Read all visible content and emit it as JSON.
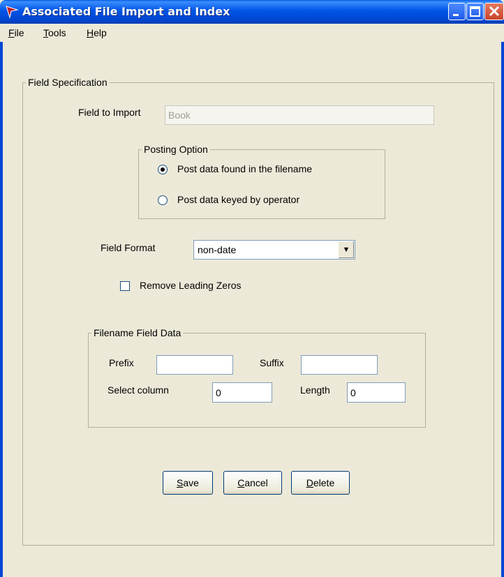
{
  "window": {
    "title": "Associated File Import and Index"
  },
  "menu": {
    "file": {
      "accel": "F",
      "rest": "ile"
    },
    "tools": {
      "accel": "T",
      "rest": "ools"
    },
    "help": {
      "accel": "H",
      "rest": "elp"
    }
  },
  "field_spec": {
    "legend": "Field Specification",
    "field_to_import_label": "Field to Import",
    "field_to_import_value": "Book"
  },
  "posting_option": {
    "legend": "Posting Option",
    "options": [
      {
        "label": "Post data found in the filename",
        "selected": true
      },
      {
        "label": "Post data keyed by operator",
        "selected": false
      }
    ]
  },
  "field_format": {
    "label": "Field Format",
    "value": "non-date"
  },
  "remove_leading_zeros": {
    "label": "Remove Leading Zeros",
    "checked": false
  },
  "filename_field_data": {
    "legend": "Filename Field Data",
    "prefix_label": "Prefix",
    "prefix_value": "",
    "suffix_label": "Suffix",
    "suffix_value": "",
    "select_column_label": "Select column",
    "select_column_value": "0",
    "length_label": "Length",
    "length_value": "0"
  },
  "buttons": {
    "save": {
      "accel": "S",
      "rest": "ave"
    },
    "cancel": {
      "accel": "C",
      "rest": "ancel"
    },
    "delete": {
      "accel": "D",
      "rest": "elete"
    }
  },
  "colors": {
    "titlebar": "#0055e5",
    "dialog_bg": "#ece9d8",
    "close_button": "#c6432a"
  }
}
